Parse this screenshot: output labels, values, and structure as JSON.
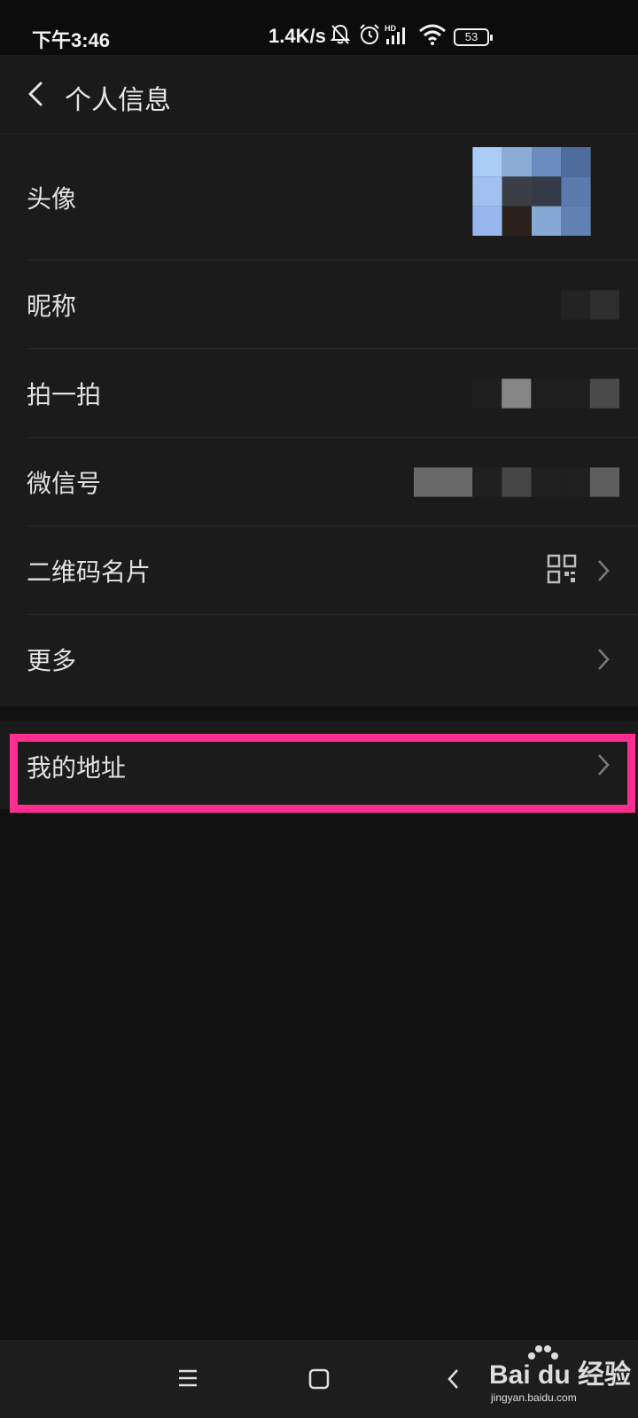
{
  "status_bar": {
    "time": "下午3:46",
    "net_speed": "1.4K/s",
    "battery_level": "53",
    "icons": [
      "mute-bell-icon",
      "alarm-icon",
      "hd-signal-icon",
      "wifi-icon",
      "battery-icon"
    ]
  },
  "header": {
    "title": "个人信息",
    "back_icon": "chevron-left-icon"
  },
  "profile_items": [
    {
      "label": "头像"
    },
    {
      "label": "昵称"
    },
    {
      "label": "拍一拍"
    },
    {
      "label": "微信号"
    },
    {
      "label": "二维码名片",
      "icon": "qr-code-icon"
    },
    {
      "label": "更多"
    }
  ],
  "address_item": {
    "label": "我的地址"
  },
  "watermark": {
    "brand": "Bai du 经验",
    "url": "jingyan.baidu.com"
  },
  "colors": {
    "background": "#111111",
    "row_background": "#1b1b1b",
    "highlight_border": "#ff2d8f"
  }
}
